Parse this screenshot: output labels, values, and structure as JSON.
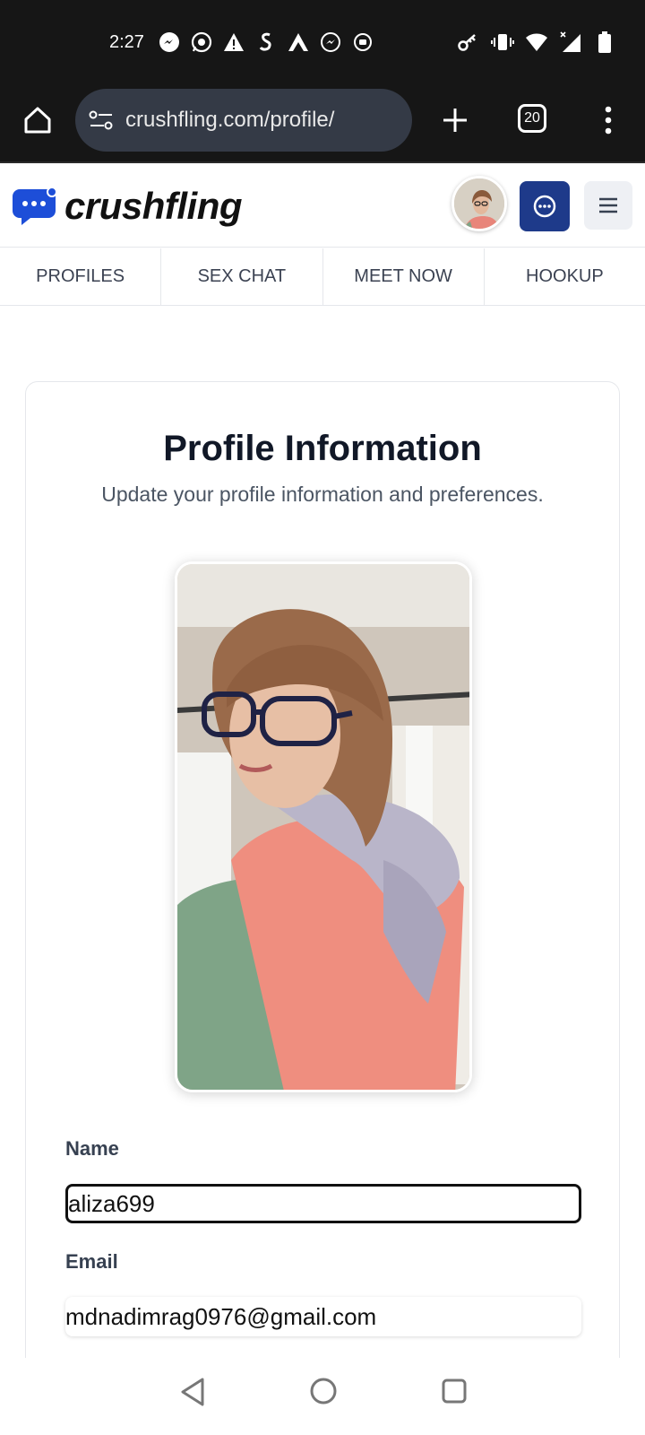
{
  "status_bar": {
    "time": "2:27",
    "left_icons": [
      "messenger-icon",
      "whatsapp-icon",
      "alert-icon",
      "snapchat-like-icon",
      "nordvpn-icon",
      "messenger-icon",
      "record-icon"
    ],
    "right_icons": [
      "key-icon",
      "vibrate-icon",
      "wifi-icon",
      "signal-icon",
      "battery-icon"
    ]
  },
  "browser": {
    "url": "crushfling.com/profile/",
    "tab_count": "20"
  },
  "site": {
    "brand": "crushfling",
    "brand_color": "#1d4ed8",
    "nav": [
      {
        "label": "PROFILES"
      },
      {
        "label": "SEX CHAT"
      },
      {
        "label": "MEET NOW"
      },
      {
        "label": "HOOKUP"
      }
    ]
  },
  "profile": {
    "title": "Profile Information",
    "subtitle": "Update your profile information and preferences.",
    "name_label": "Name",
    "name_value": "aliza699",
    "email_label": "Email",
    "email_value": "mdnadimrag0976@gmail.com"
  }
}
